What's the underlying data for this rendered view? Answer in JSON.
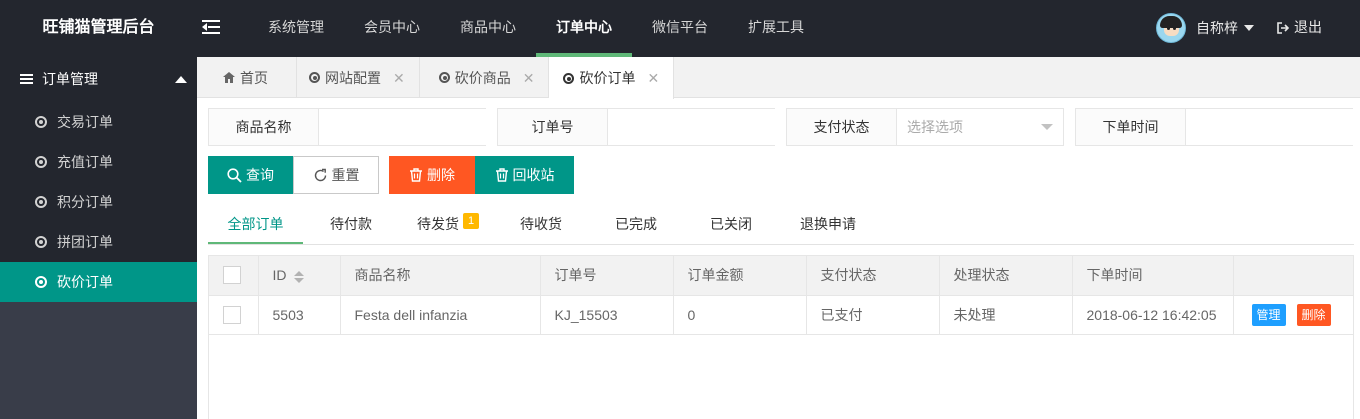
{
  "header": {
    "brand": "旺铺猫管理后台",
    "nav": [
      "系统管理",
      "会员中心",
      "商品中心",
      "订单中心",
      "微信平台",
      "扩展工具"
    ],
    "active_nav": "订单中心",
    "username": "自称梓",
    "logout": "退出"
  },
  "sidebar": {
    "group": "订单管理",
    "items": [
      "交易订单",
      "充值订单",
      "积分订单",
      "拼团订单",
      "砍价订单"
    ],
    "active": "砍价订单"
  },
  "tabs": [
    {
      "label": "首页",
      "icon": "home-icon",
      "closable": false
    },
    {
      "label": "网站配置",
      "icon": "circle-dot-icon",
      "closable": true
    },
    {
      "label": "砍价商品",
      "icon": "circle-dot-icon",
      "closable": true
    },
    {
      "label": "砍价订单",
      "icon": "circle-dot-icon",
      "closable": true,
      "active": true
    }
  ],
  "search": {
    "product_name_label": "商品名称",
    "product_name_value": "",
    "order_no_label": "订单号",
    "order_no_value": "",
    "pay_status_label": "支付状态",
    "pay_status_placeholder": "选择选项",
    "order_time_label": "下单时间",
    "order_time_value": ""
  },
  "buttons": {
    "query": "查询",
    "reset": "重置",
    "delete": "删除",
    "recycle": "回收站"
  },
  "status_tabs": {
    "all": "全部订单",
    "unpaid": "待付款",
    "to_ship": "待发货",
    "to_ship_badge": "1",
    "to_receive": "待收货",
    "done": "已完成",
    "closed": "已关闭",
    "refund": "退换申请"
  },
  "table": {
    "headers": {
      "id": "ID",
      "name": "商品名称",
      "order_no": "订单号",
      "amount": "订单金额",
      "pay_status": "支付状态",
      "process_status": "处理状态",
      "order_time": "下单时间"
    },
    "rows": [
      {
        "id": "5503",
        "name": "Festa dell infanzia",
        "order_no": "KJ_15503",
        "amount": "0",
        "pay_status": "已支付",
        "process_status": "未处理",
        "order_time": "2018-06-12 16:42:05",
        "manage": "管理",
        "delete": "删除"
      }
    ]
  },
  "colors": {
    "header_bg": "#23262e",
    "sidebar_bg": "#393d49",
    "primary": "#009688",
    "danger": "#ff5722",
    "info": "#1e9fff",
    "badge": "#ffb800",
    "active_line": "#5fb878"
  }
}
